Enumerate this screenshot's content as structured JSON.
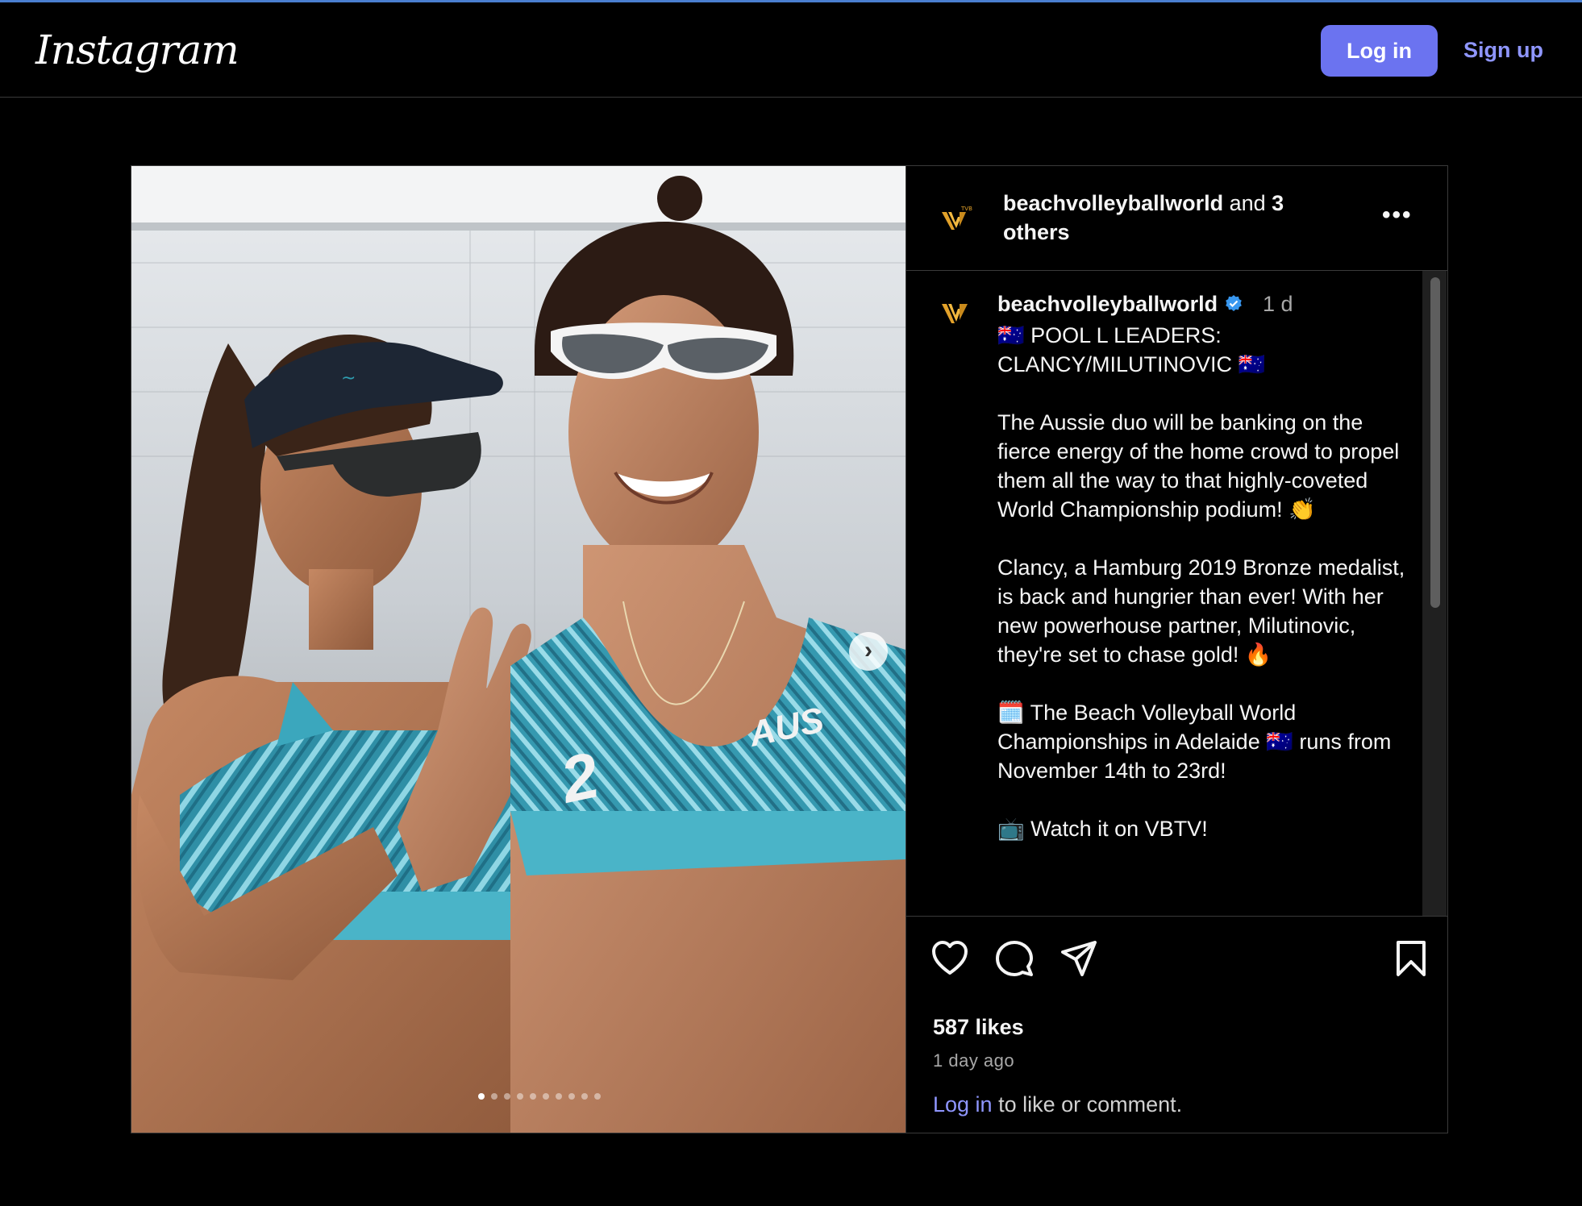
{
  "navbar": {
    "logo": "Instagram",
    "login_label": "Log in",
    "signup_label": "Sign up"
  },
  "post": {
    "header": {
      "username": "beachvolleyballworld",
      "and_text": " and ",
      "others": "3 others",
      "more_label": "•••"
    },
    "caption": {
      "username": "beachvolleyballworld",
      "time": "1 d",
      "text": "🇦🇺 POOL L LEADERS: CLANCY/MILUTINOVIC 🇦🇺\n\nThe Aussie duo will be banking on the fierce energy of the home crowd to propel them all the way to that highly-coveted World Championship podium! 👏\n\nClancy, a Hamburg 2019 Bronze medalist, is back and hungrier than ever! With her new powerhouse partner, Milutinovic, they're set to chase gold! 🔥\n\n🗓️ The Beach Volleyball World Championships in Adelaide 🇦🇺 runs from November 14th to 23rd!\n\n📺 Watch it on VBTV!"
    },
    "media": {
      "next_label": "›",
      "jersey_text": "AUS",
      "jersey_number": "2"
    },
    "likes": "587 likes",
    "time_ago": "1 day ago",
    "login_prompt": {
      "link": "Log in",
      "rest": " to like or comment."
    }
  },
  "icons": {
    "like": "heart-icon",
    "comment": "comment-icon",
    "share": "share-icon",
    "save": "bookmark-icon",
    "verified": "verified-badge-icon"
  },
  "colors": {
    "accent": "#6b73f0",
    "link": "#8f96ff",
    "verified": "#3897f0",
    "brand_gold": "#e2a12a"
  }
}
